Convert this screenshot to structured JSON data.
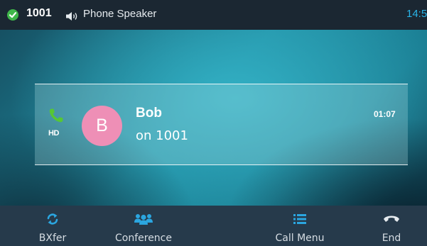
{
  "status_bar": {
    "extension": "1001",
    "audio_mode": "Phone Speaker",
    "clock": "14:5"
  },
  "call": {
    "avatar_initial": "B",
    "caller_name": "Bob",
    "line": "on 1001",
    "duration": "01:07",
    "hd_label": "HD"
  },
  "softkeys": [
    {
      "label": "BXfer",
      "icon": "transfer-icon"
    },
    {
      "label": "Conference",
      "icon": "conference-icon"
    },
    {
      "label": "Call Menu",
      "icon": "menu-icon"
    },
    {
      "label": "End",
      "icon": "end-call-icon"
    }
  ],
  "colors": {
    "status_ok": "#3fb64a",
    "accent": "#29b4e8",
    "avatar": "#ee8fb6",
    "call_active": "#57c734",
    "softkey_icon": "#2ba6e0"
  }
}
